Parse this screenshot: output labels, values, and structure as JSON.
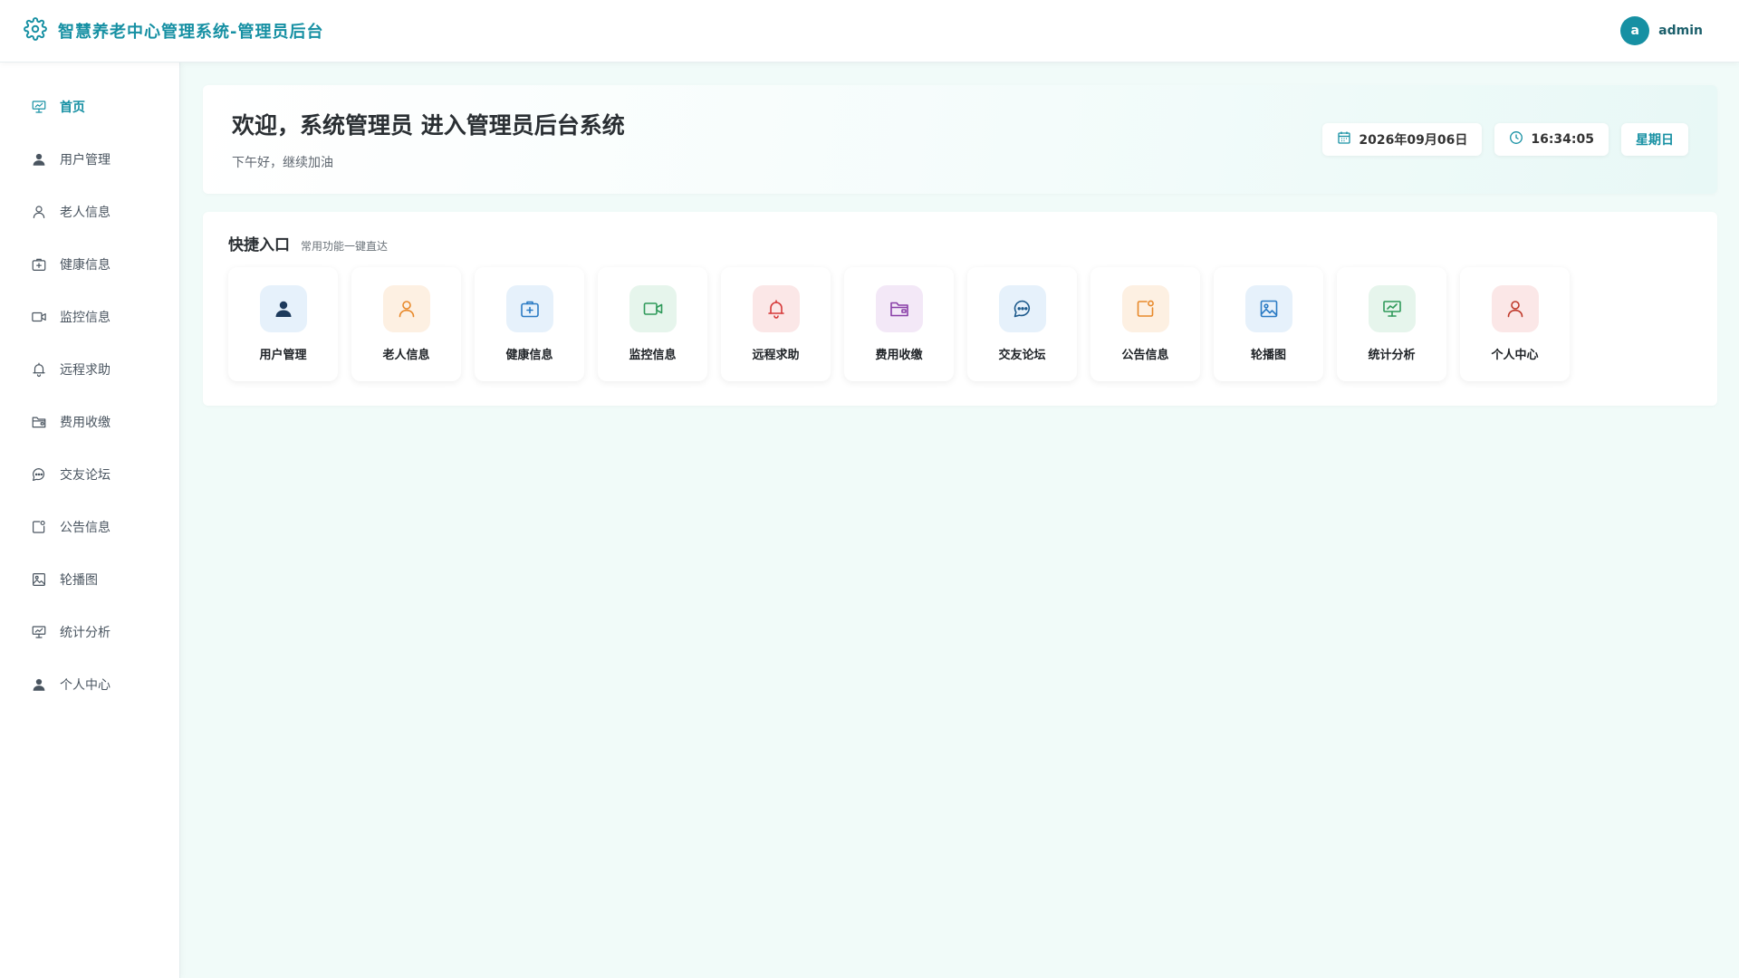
{
  "header": {
    "title": "智慧养老中心管理系统-管理员后台",
    "icon": "gear-icon",
    "avatar_letter": "a",
    "username": "admin"
  },
  "sidebar": {
    "items": [
      {
        "label": "首页",
        "icon": "presentation-icon",
        "active": true
      },
      {
        "label": "用户管理",
        "icon": "user-filled-icon"
      },
      {
        "label": "老人信息",
        "icon": "user-outline-icon"
      },
      {
        "label": "健康信息",
        "icon": "first-aid-icon"
      },
      {
        "label": "监控信息",
        "icon": "camera-icon"
      },
      {
        "label": "远程求助",
        "icon": "bell-icon"
      },
      {
        "label": "费用收缴",
        "icon": "wallet-icon"
      },
      {
        "label": "交友论坛",
        "icon": "chat-icon"
      },
      {
        "label": "公告信息",
        "icon": "notice-icon"
      },
      {
        "label": "轮播图",
        "icon": "picture-icon"
      },
      {
        "label": "统计分析",
        "icon": "presentation-icon"
      },
      {
        "label": "个人中心",
        "icon": "user-filled-icon"
      }
    ]
  },
  "welcome": {
    "title": "欢迎，系统管理员 进入管理员后台系统",
    "subtitle": "下午好，继续加油",
    "date": "2026年09月06日",
    "time": "16:34:05",
    "weekday": "星期日"
  },
  "quick": {
    "title": "快捷入口",
    "subtitle": "常用功能一键直达",
    "tiles": [
      {
        "label": "用户管理",
        "icon": "user-filled-icon",
        "bg": "#e6f1fb",
        "color": "#1d3a5c"
      },
      {
        "label": "老人信息",
        "icon": "user-outline-icon",
        "bg": "#fdf0e2",
        "color": "#e8892a"
      },
      {
        "label": "健康信息",
        "icon": "first-aid-icon",
        "bg": "#e6f1fb",
        "color": "#2b7bc4"
      },
      {
        "label": "监控信息",
        "icon": "camera-icon",
        "bg": "#e6f5ec",
        "color": "#2f9a5a"
      },
      {
        "label": "远程求助",
        "icon": "bell-icon",
        "bg": "#fbe7e7",
        "color": "#d63a3a"
      },
      {
        "label": "费用收缴",
        "icon": "wallet-icon",
        "bg": "#f3e8f7",
        "color": "#8a3fa8"
      },
      {
        "label": "交友论坛",
        "icon": "chat-icon",
        "bg": "#e6f1fb",
        "color": "#1d5a8c"
      },
      {
        "label": "公告信息",
        "icon": "notice-icon",
        "bg": "#fdf0e2",
        "color": "#e8892a"
      },
      {
        "label": "轮播图",
        "icon": "picture-icon",
        "bg": "#e6f1fb",
        "color": "#2b7bc4"
      },
      {
        "label": "统计分析",
        "icon": "presentation-icon",
        "bg": "#e6f5ec",
        "color": "#2f9a5a"
      },
      {
        "label": "个人中心",
        "icon": "user-outline-icon",
        "bg": "#fbe7e7",
        "color": "#c0392b"
      }
    ]
  },
  "colors": {
    "accent": "#1690a3",
    "background": "#f1fbf9"
  }
}
